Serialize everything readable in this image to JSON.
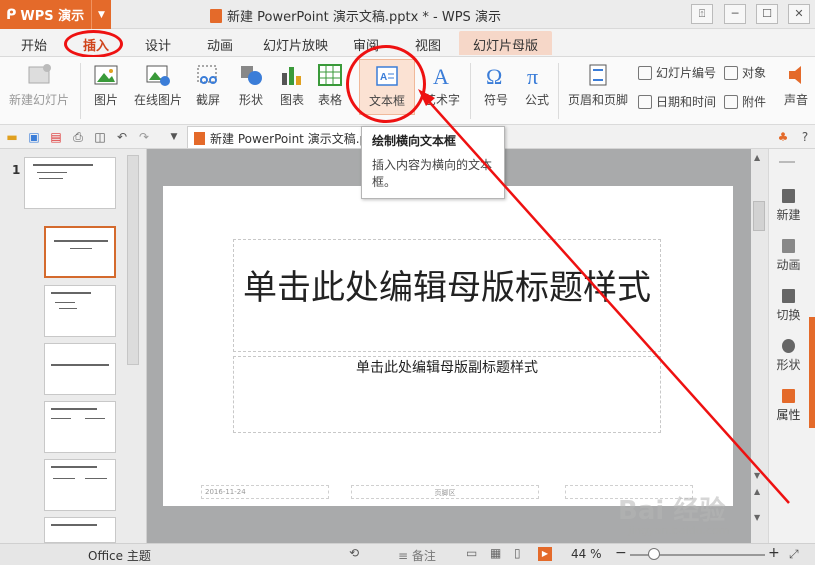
{
  "app": {
    "name": "WPS 演示",
    "window_title": "新建 PowerPoint 演示文稿.pptx * - WPS 演示"
  },
  "tabs": [
    "开始",
    "插入",
    "设计",
    "动画",
    "幻灯片放映",
    "审阅",
    "视图",
    "幻灯片母版"
  ],
  "active_tab": "插入",
  "ribbon": {
    "new_slide": "新建幻灯片",
    "picture": "图片",
    "online_picture": "在线图片",
    "screenshot": "截屏",
    "shape": "形状",
    "chart": "图表",
    "table": "表格",
    "textbox": "文本框",
    "wordart": "艺术字",
    "symbol": "符号",
    "formula": "公式",
    "header_footer": "页眉和页脚",
    "slide_number": "幻灯片编号",
    "object": "对象",
    "date_time": "日期和时间",
    "attachment": "附件",
    "sound": "声音"
  },
  "document_tab": "新建 PowerPoint 演示文稿.pptx",
  "tooltip": {
    "title": "绘制横向文本框",
    "description": "插入内容为横向的文本框。"
  },
  "thumbnails": {
    "first_number": "1"
  },
  "slide": {
    "title": "单击此处编辑母版标题样式",
    "subtitle": "单击此处编辑母版副标题样式",
    "footer_date": "2016-11-24",
    "footer_text": "页脚区"
  },
  "right_panel": [
    "新建",
    "动画",
    "切换",
    "形状",
    "属性"
  ],
  "status": {
    "theme": "Office 主题",
    "notes": "备注",
    "zoom": "44 %"
  },
  "watermark": {
    "main": "Bai 经验",
    "sub": "jingyan.baidu.com"
  },
  "colors": {
    "accent": "#e46a2a",
    "annotation": "#e11111"
  }
}
